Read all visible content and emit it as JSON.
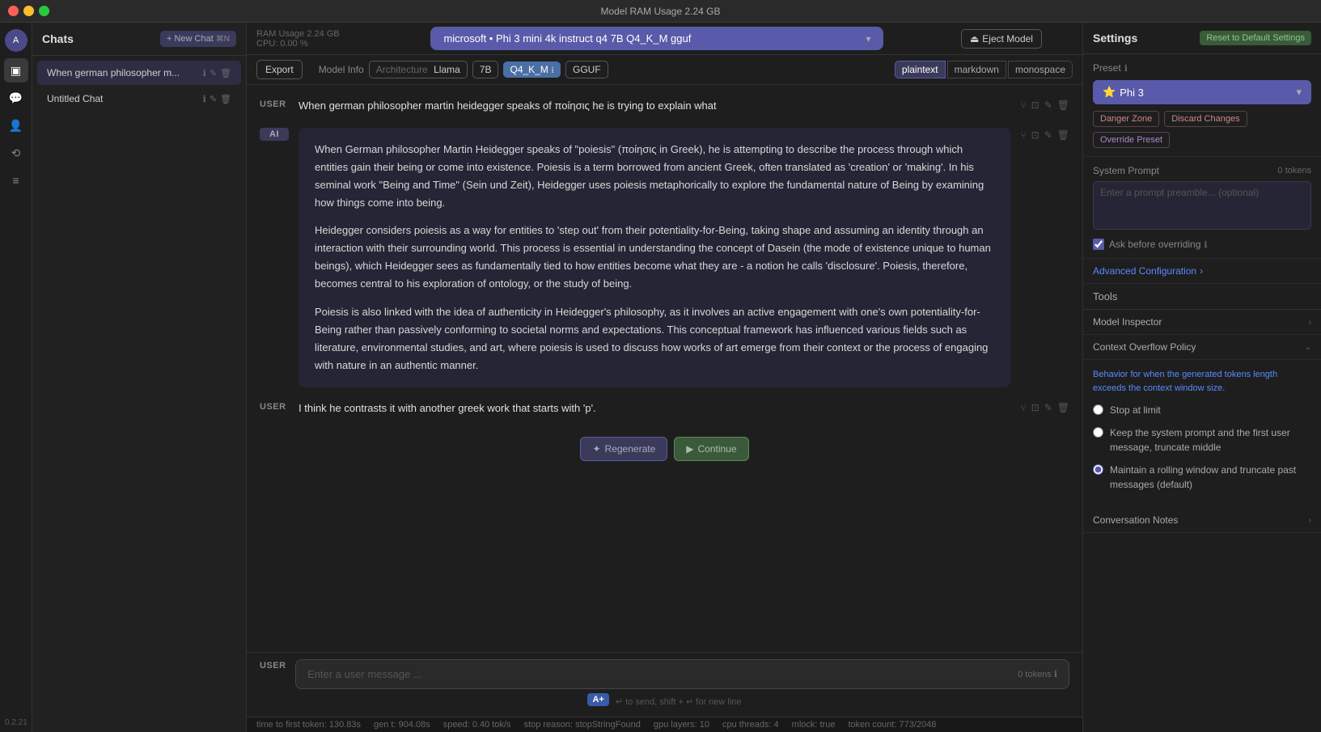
{
  "titleBar": {
    "text": "Model RAM Usage  2.24 GB"
  },
  "iconBar": {
    "icons": [
      {
        "name": "home-icon",
        "symbol": "⌂",
        "active": false
      },
      {
        "name": "sidebar-icon",
        "symbol": "▣",
        "active": false
      },
      {
        "name": "chat-icon",
        "symbol": "💬",
        "active": true
      },
      {
        "name": "person-icon",
        "symbol": "👤",
        "active": false
      },
      {
        "name": "arrow-icon",
        "symbol": "⟲",
        "active": false
      },
      {
        "name": "layers-icon",
        "symbol": "≡",
        "active": false
      }
    ]
  },
  "sidebar": {
    "title": "Chats",
    "newChatLabel": "+ New Chat",
    "newChatShortcut": "⌘N",
    "chats": [
      {
        "id": "1",
        "name": "When german philosopher m...",
        "active": true
      },
      {
        "id": "2",
        "name": "Untitled Chat",
        "active": false
      }
    ]
  },
  "modelBar": {
    "modelName": "microsoft • Phi 3 mini 4k instruct q4 7B Q4_K_M gguf",
    "ejectLabel": "Eject Model",
    "ramLabel": "RAM Usage",
    "ramValue": "2.24 GB",
    "cpuLabel": "CPU:",
    "cpuValue": "0.00 %"
  },
  "toolbar": {
    "exportLabel": "Export",
    "modelInfoLabel": "Model Info",
    "architectureLabel": "Architecture",
    "architectureValue": "Llama",
    "paramValue": "7B",
    "quantValue": "Q4_K_M",
    "formatValue": "GGUF",
    "viewButtons": [
      "plaintext",
      "markdown",
      "monospace"
    ],
    "activeView": "plaintext"
  },
  "messages": [
    {
      "role": "USER",
      "text": "When german philosopher martin heidegger speaks of ποίησις he is trying to explain what"
    },
    {
      "role": "AI",
      "paragraphs": [
        "When German philosopher Martin Heidegger speaks of \"poiesis\" (ποίησις in Greek), he is attempting to describe the process through which entities gain their being or come into existence. Poiesis is a term borrowed from ancient Greek, often translated as 'creation' or 'making'. In his seminal work \"Being and Time\" (Sein und Zeit), Heidegger uses poiesis metaphorically to explore the fundamental nature of Being by examining how things come into being.",
        "Heidegger considers poiesis as a way for entities to 'step out' from their potentiality-for-Being, taking shape and assuming an identity through an interaction with their surrounding world. This process is essential in understanding the concept of Dasein (the mode of existence unique to human beings), which Heidegger sees as fundamentally tied to how entities become what they are - a notion he calls 'disclosure'. Poiesis, therefore, becomes central to his exploration of ontology, or the study of being.",
        "Poiesis is also linked with the idea of authenticity in Heidegger's philosophy, as it involves an active engagement with one's own potentiality-for-Being rather than passively conforming to societal norms and expectations. This conceptual framework has influenced various fields such as literature, environmental studies, and art, where poiesis is used to discuss how works of art emerge from their context or the process of engaging with nature in an authentic manner."
      ]
    },
    {
      "role": "USER",
      "text": "I think he contrasts it with another greek work that starts with 'p'."
    }
  ],
  "actionButtons": {
    "regenerateLabel": "Regenerate",
    "continueLabel": "Continue"
  },
  "inputArea": {
    "placeholder": "Enter a user message ...",
    "tokenCount": "0 tokens",
    "sendHint": "↵ to send, shift + ↵ for new line",
    "apBadge": "A+"
  },
  "statusBar": {
    "timeToFirst": "time to first token: 130.83s",
    "genT": "gen t: 904.08s",
    "speed": "speed: 0.40 tok/s",
    "stopReason": "stop reason: stopStringFound",
    "gpuLayers": "gpu layers: 10",
    "cpuThreads": "cpu threads: 4",
    "mlock": "mlock: true",
    "tokenCount": "token count: 773/2048"
  },
  "settings": {
    "title": "Settings",
    "resetLabel": "Reset to Default Settings",
    "preset": {
      "label": "Preset",
      "value": "Phi 3"
    },
    "dangerZone": "Danger Zone",
    "discardChanges": "Discard Changes",
    "overridePreset": "Override Preset",
    "systemPrompt": {
      "label": "System Prompt",
      "tokenCount": "0 tokens",
      "placeholder": "Enter a prompt preamble... (optional)"
    },
    "askBeforeOverriding": "Ask before overriding",
    "advancedConfig": "Advanced Configuration",
    "tools": "Tools",
    "modelInspector": "Model Inspector",
    "contextOverflowPolicy": "Context Overflow Policy",
    "contextPolicyDesc": "Behavior for when the generated tokens length exceeds the context window size.",
    "radioOptions": [
      {
        "id": "stop",
        "label": "Stop at limit",
        "checked": false
      },
      {
        "id": "truncate-middle",
        "label": "Keep the system prompt and the first user message, truncate middle",
        "checked": false
      },
      {
        "id": "rolling",
        "label": "Maintain a rolling window and truncate past messages (default)",
        "checked": true
      }
    ],
    "conversationNotes": "Conversation Notes",
    "version": "0.2.21"
  }
}
